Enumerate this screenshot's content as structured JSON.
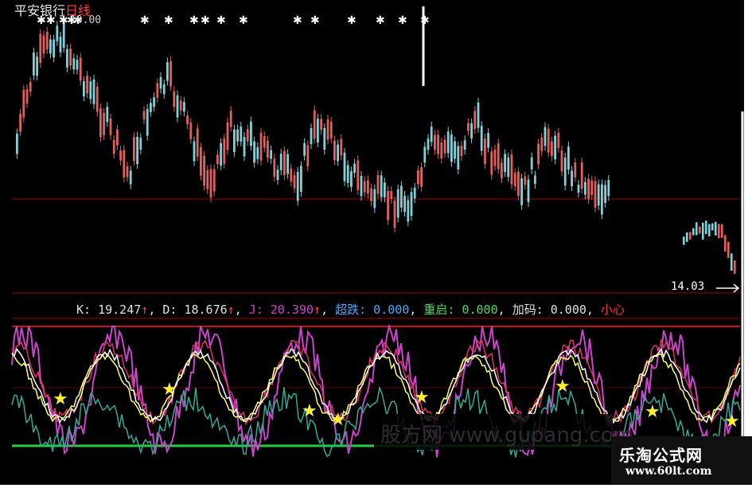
{
  "header": {
    "stock_name": "平安银行",
    "period_label": "日线",
    "high_marker": "19.00",
    "low_marker": "14.03"
  },
  "indicator_row": {
    "k": "K: 19.247",
    "d": "D: 18.676",
    "j": "J: 20.390",
    "chaodie": "超跌: 0.000",
    "chongqi": "重启: 0.000",
    "jiama": "加码: 0.000",
    "xiaoxin": "小心"
  },
  "watermark": {
    "site_name": "乐淘公式网",
    "url": "www.60lt.com",
    "overlay_text": "股方网 www.gupang.com"
  },
  "colors": {
    "background": "#000000",
    "up_candle": "#e06060",
    "down_candle": "#7fd0d8",
    "k_line": "#ffffff",
    "d_line": "#ffff66",
    "j_line": "#cc44cc",
    "green_line": "#22cc44",
    "grid_red": "#a00000",
    "star": "#ffee33"
  }
}
